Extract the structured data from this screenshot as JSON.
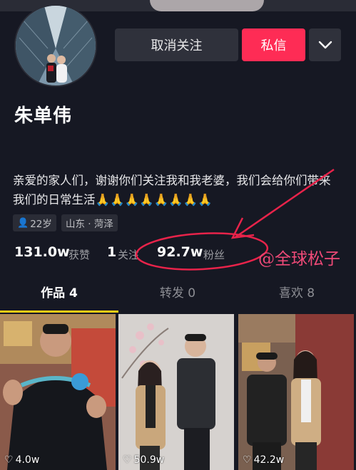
{
  "header": {
    "unfollow_label": "取消关注",
    "message_label": "私信",
    "more_icon": "chevron-down-icon"
  },
  "profile": {
    "name": "朱单伟",
    "bio": "亲爱的家人们，谢谢你们关注我和我老婆，我们会给你们带来我们的日常生活🙏🙏🙏🙏🙏🙏🙏🙏",
    "tags": {
      "age": "22岁",
      "location": "山东 · 菏泽"
    }
  },
  "stats": {
    "likes_value": "131.0w",
    "likes_label": "获赞",
    "following_value": "1",
    "following_label": "关注",
    "followers_value": "92.7w",
    "followers_label": "粉丝"
  },
  "watermark": "@全球松子",
  "tabs": [
    {
      "label": "作品 4",
      "active": true
    },
    {
      "label": "转发 0",
      "active": false
    },
    {
      "label": "喜欢 8",
      "active": false
    }
  ],
  "videos": [
    {
      "likes": "4.0w"
    },
    {
      "likes": "50.9w"
    },
    {
      "likes": "42.2w"
    }
  ],
  "colors": {
    "background": "#161823",
    "accent": "#fe2c55",
    "tab_indicator": "#face15",
    "annotation": "#e8234a"
  }
}
